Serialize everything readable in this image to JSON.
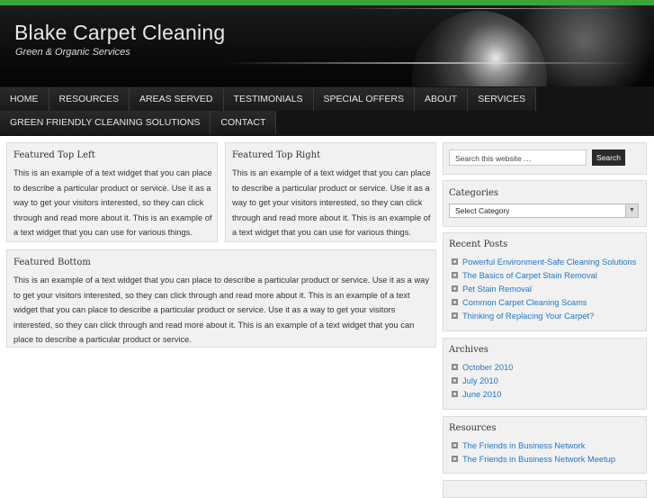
{
  "site": {
    "title": "Blake Carpet Cleaning",
    "tagline": "Green & Organic Services"
  },
  "colors": {
    "accent": "#3aa63a",
    "link": "#2277cc",
    "header_bg": "#0c0c0c"
  },
  "nav": {
    "row1": [
      "HOME",
      "RESOURCES",
      "AREAS SERVED",
      "TESTIMONIALS",
      "SPECIAL OFFERS",
      "ABOUT",
      "SERVICES"
    ],
    "row2": [
      "GREEN FRIENDLY CLEANING SOLUTIONS",
      "CONTACT"
    ]
  },
  "widgets": {
    "top_left": {
      "title": "Featured Top Left",
      "lines": [
        "This is an example of a text widget that you can place",
        "to describe a particular product or service. Use it as a",
        "way to get your visitors interested, so they can click",
        "through and read more about it. This is an example of",
        "a text widget that you can use for various things."
      ]
    },
    "top_right": {
      "title": "Featured Top Right",
      "lines": [
        "This is an example of a text widget that you can place",
        "to describe a particular product or service. Use it as a",
        "way to get your visitors interested, so they can click",
        "through and read more about it. This is an example of",
        "a text widget that you can use for various things."
      ]
    },
    "bottom": {
      "title": "Featured Bottom",
      "lines": [
        "This is an example of a text widget that you can place to describe a particular product or service. Use it as a way",
        "to get your visitors interested, so they can click through and read more about it. This is an example of a text",
        "widget that you can place to describe a particular product or service. Use it as a way to get your visitors",
        "interested, so they can click through and read more about it. This is an example of a text widget that you can",
        "place to describe a particular product or service."
      ]
    }
  },
  "sidebar": {
    "search": {
      "placeholder": "Search this website …",
      "button": "Search"
    },
    "categories": {
      "title": "Categories",
      "selected": "Select Category"
    },
    "recent_posts": {
      "title": "Recent Posts",
      "items": [
        "Powerful Environment-Safe Cleaning Solutions",
        "The Basics of Carpet Stain Removal",
        "Pet Stain Removal",
        "Common Carpet Cleaning Scams",
        "Thinking of Replacing Your Carpet?"
      ]
    },
    "archives": {
      "title": "Archives",
      "items": [
        "October 2010",
        "July 2010",
        "June 2010"
      ]
    },
    "resources": {
      "title": "Resources",
      "items": [
        "The Friends in Business Network",
        "The Friends in Business Network Meetup"
      ]
    }
  }
}
